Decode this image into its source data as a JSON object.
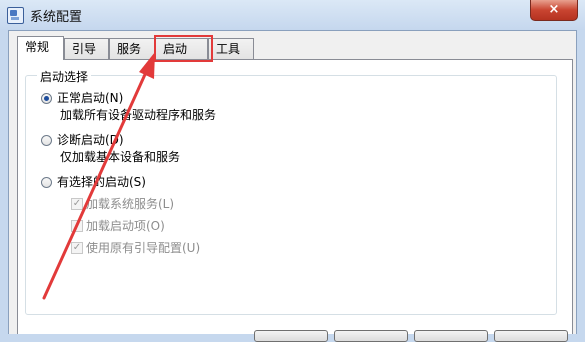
{
  "window": {
    "title": "系统配置",
    "close_label": "×"
  },
  "tabs": [
    {
      "label": "常规",
      "active": true
    },
    {
      "label": "引导",
      "active": false
    },
    {
      "label": "服务",
      "active": false
    },
    {
      "label": "启动",
      "active": false
    },
    {
      "label": "工具",
      "active": false
    }
  ],
  "startup_selection": {
    "legend": "启动选择",
    "options": [
      {
        "label": "正常启动(N)",
        "description": "加载所有设备驱动程序和服务",
        "selected": true
      },
      {
        "label": "诊断启动(D)",
        "description": "仅加载基本设备和服务",
        "selected": false
      },
      {
        "label": "有选择的启动(S)",
        "selected": false
      }
    ],
    "selective_items": [
      {
        "label": "加载系统服务(L)",
        "checked": true
      },
      {
        "label": "加载启动项(O)",
        "checked": false
      },
      {
        "label": "使用原有引导配置(U)",
        "checked": true
      }
    ]
  },
  "colors": {
    "annotation": "#e23a3a",
    "title_bar": "#c5d7ee",
    "close_button": "#c94531"
  }
}
